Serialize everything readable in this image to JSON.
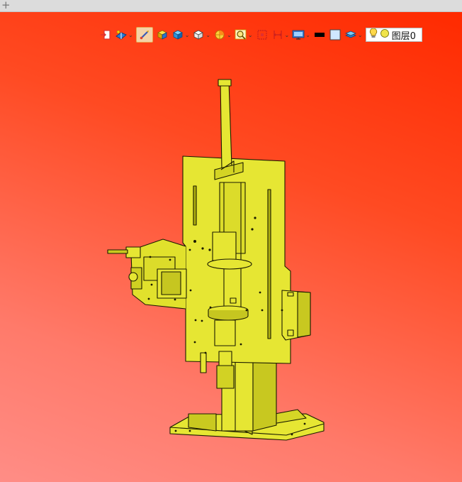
{
  "tabbar": {
    "new_tab_label": "+"
  },
  "toolbar": {
    "layer": {
      "name": "图层0"
    }
  },
  "colors": {
    "model_fill": "#e6e633",
    "model_stroke": "#1a1a00",
    "background_top": "#ff2a00",
    "background_bottom": "#ff8d86",
    "active_tool_bg": "#f5d3a7"
  },
  "icons": [
    "exit-icon",
    "render-style-icon",
    "measure-icon",
    "box-shading-icon",
    "cube-views-icon",
    "wireframe-cube-icon",
    "section-icon",
    "zoom-icon",
    "red-square-icon",
    "dimension-icon",
    "display-monitor-icon",
    "color-black-icon",
    "color-lightblue-icon",
    "layer-stack-icon",
    "lightbulb-icon",
    "sun-icon"
  ]
}
